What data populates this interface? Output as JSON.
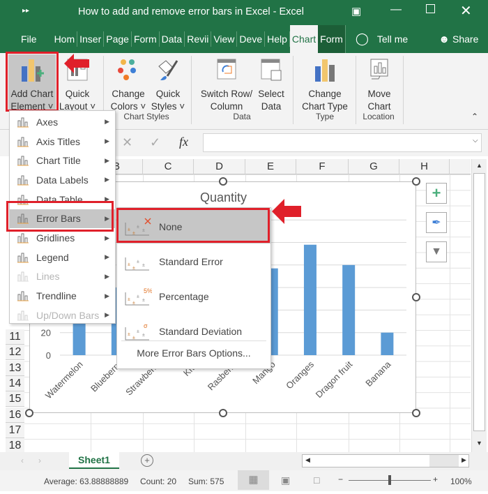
{
  "window": {
    "title": "How to add and remove error bars in Excel  -  Excel",
    "accent": "#217346"
  },
  "tabs": [
    "File",
    "Hom",
    "Inser",
    "Page",
    "Form",
    "Data",
    "Reviі",
    "View",
    "Deve",
    "Help",
    "Chart",
    "Form"
  ],
  "tell_me": "Tell me",
  "share": "Share",
  "ribbon": {
    "add_chart_element": [
      "Add Chart",
      "Element ˅"
    ],
    "quick_layout": [
      "Quick",
      "Layout ˅"
    ],
    "change_colors": [
      "Change",
      "Colors ˅"
    ],
    "quick_styles": [
      "Quick",
      "Styles ˅"
    ],
    "switch_row": [
      "Switch Row/",
      "Column"
    ],
    "select_data": [
      "Select",
      "Data"
    ],
    "change_type": [
      "Change",
      "Chart Type"
    ],
    "move_chart": [
      "Move",
      "Chart"
    ],
    "groups": [
      "Chart Styles",
      "Data",
      "Type",
      "Location"
    ]
  },
  "formula": {
    "fx": "fx",
    "value": ""
  },
  "columns": [
    "B",
    "C",
    "D",
    "E",
    "F",
    "G",
    "H"
  ],
  "rows": [
    "11",
    "12",
    "13",
    "14",
    "15",
    "16",
    "17",
    "18"
  ],
  "menu": [
    {
      "label": "Axes",
      "enabled": true
    },
    {
      "label": "Axis Titles",
      "enabled": true
    },
    {
      "label": "Chart Title",
      "enabled": true
    },
    {
      "label": "Data Labels",
      "enabled": true
    },
    {
      "label": "Data Table",
      "enabled": true
    },
    {
      "label": "Error Bars",
      "enabled": true,
      "selected": true
    },
    {
      "label": "Gridlines",
      "enabled": true
    },
    {
      "label": "Legend",
      "enabled": true
    },
    {
      "label": "Lines",
      "enabled": false
    },
    {
      "label": "Trendline",
      "enabled": true
    },
    {
      "label": "Up/Down Bars",
      "enabled": false
    }
  ],
  "submenu": [
    {
      "label": "None",
      "selected": true
    },
    {
      "label": "Standard Error"
    },
    {
      "label": "Percentage",
      "badge": "5%"
    },
    {
      "label": "Standard Deviation",
      "badge": "σ"
    }
  ],
  "submenu_more": "More Error Bars Options...",
  "chart_data": {
    "type": "bar",
    "title": "Quantity",
    "categories": [
      "Watermelon",
      "Blueberry",
      "Strawberry",
      "Kiwi",
      "Rasberry",
      "Mango",
      "Oranges",
      "Dragon fruit",
      "Banana"
    ],
    "values": [
      60,
      60,
      60,
      60,
      60,
      77,
      98,
      80,
      20
    ],
    "ylim": [
      0,
      120
    ],
    "yticks_visible": [
      "0",
      "20"
    ],
    "grid": true,
    "bar_color": "#5b9bd5"
  },
  "sheet": {
    "tab": "Sheet1"
  },
  "status": {
    "average": "Average: 63.88888889",
    "count": "Count: 20",
    "sum": "Sum: 575",
    "zoom": "100%",
    "zoom_level": 100
  }
}
